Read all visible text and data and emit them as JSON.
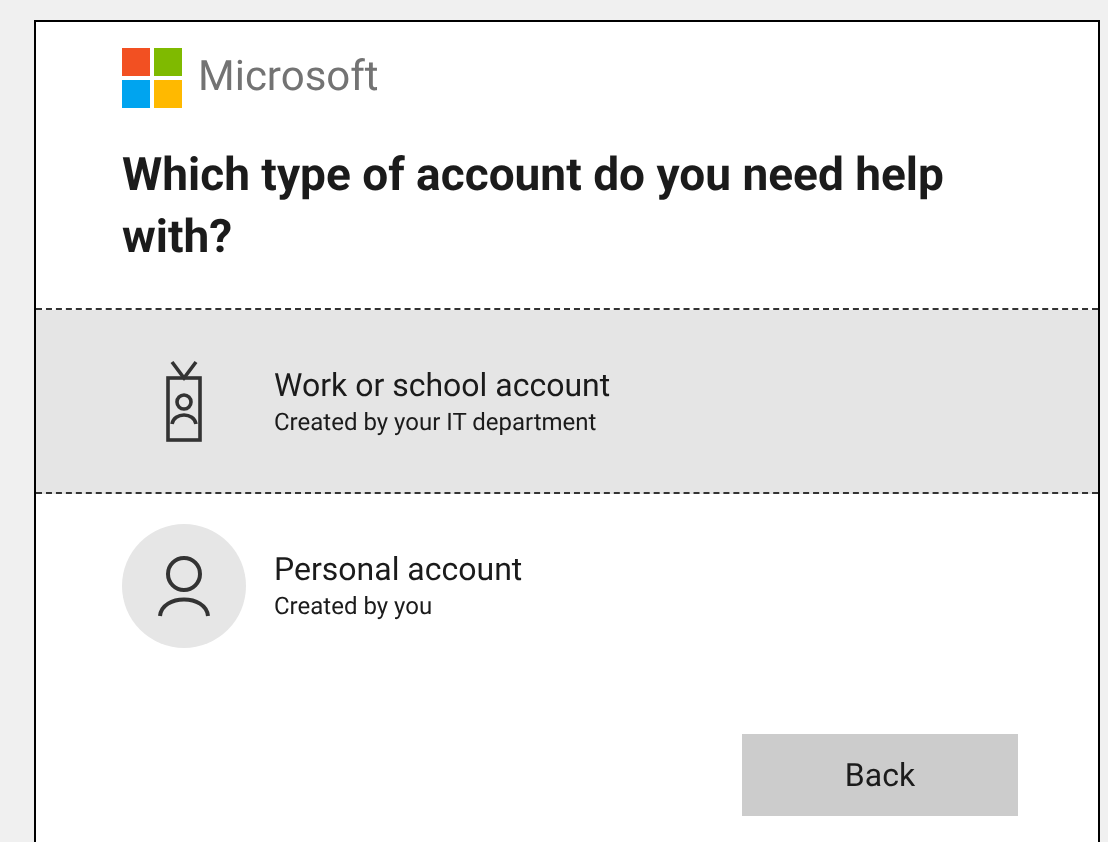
{
  "brand": {
    "name": "Microsoft"
  },
  "heading": "Which type of account do you need help with?",
  "options": [
    {
      "kind": "work",
      "title": "Work or school account",
      "subtitle": "Created by your IT department",
      "selected": true
    },
    {
      "kind": "personal",
      "title": "Personal account",
      "subtitle": "Created by you",
      "selected": false
    }
  ],
  "buttons": [
    {
      "label": "Back"
    }
  ]
}
